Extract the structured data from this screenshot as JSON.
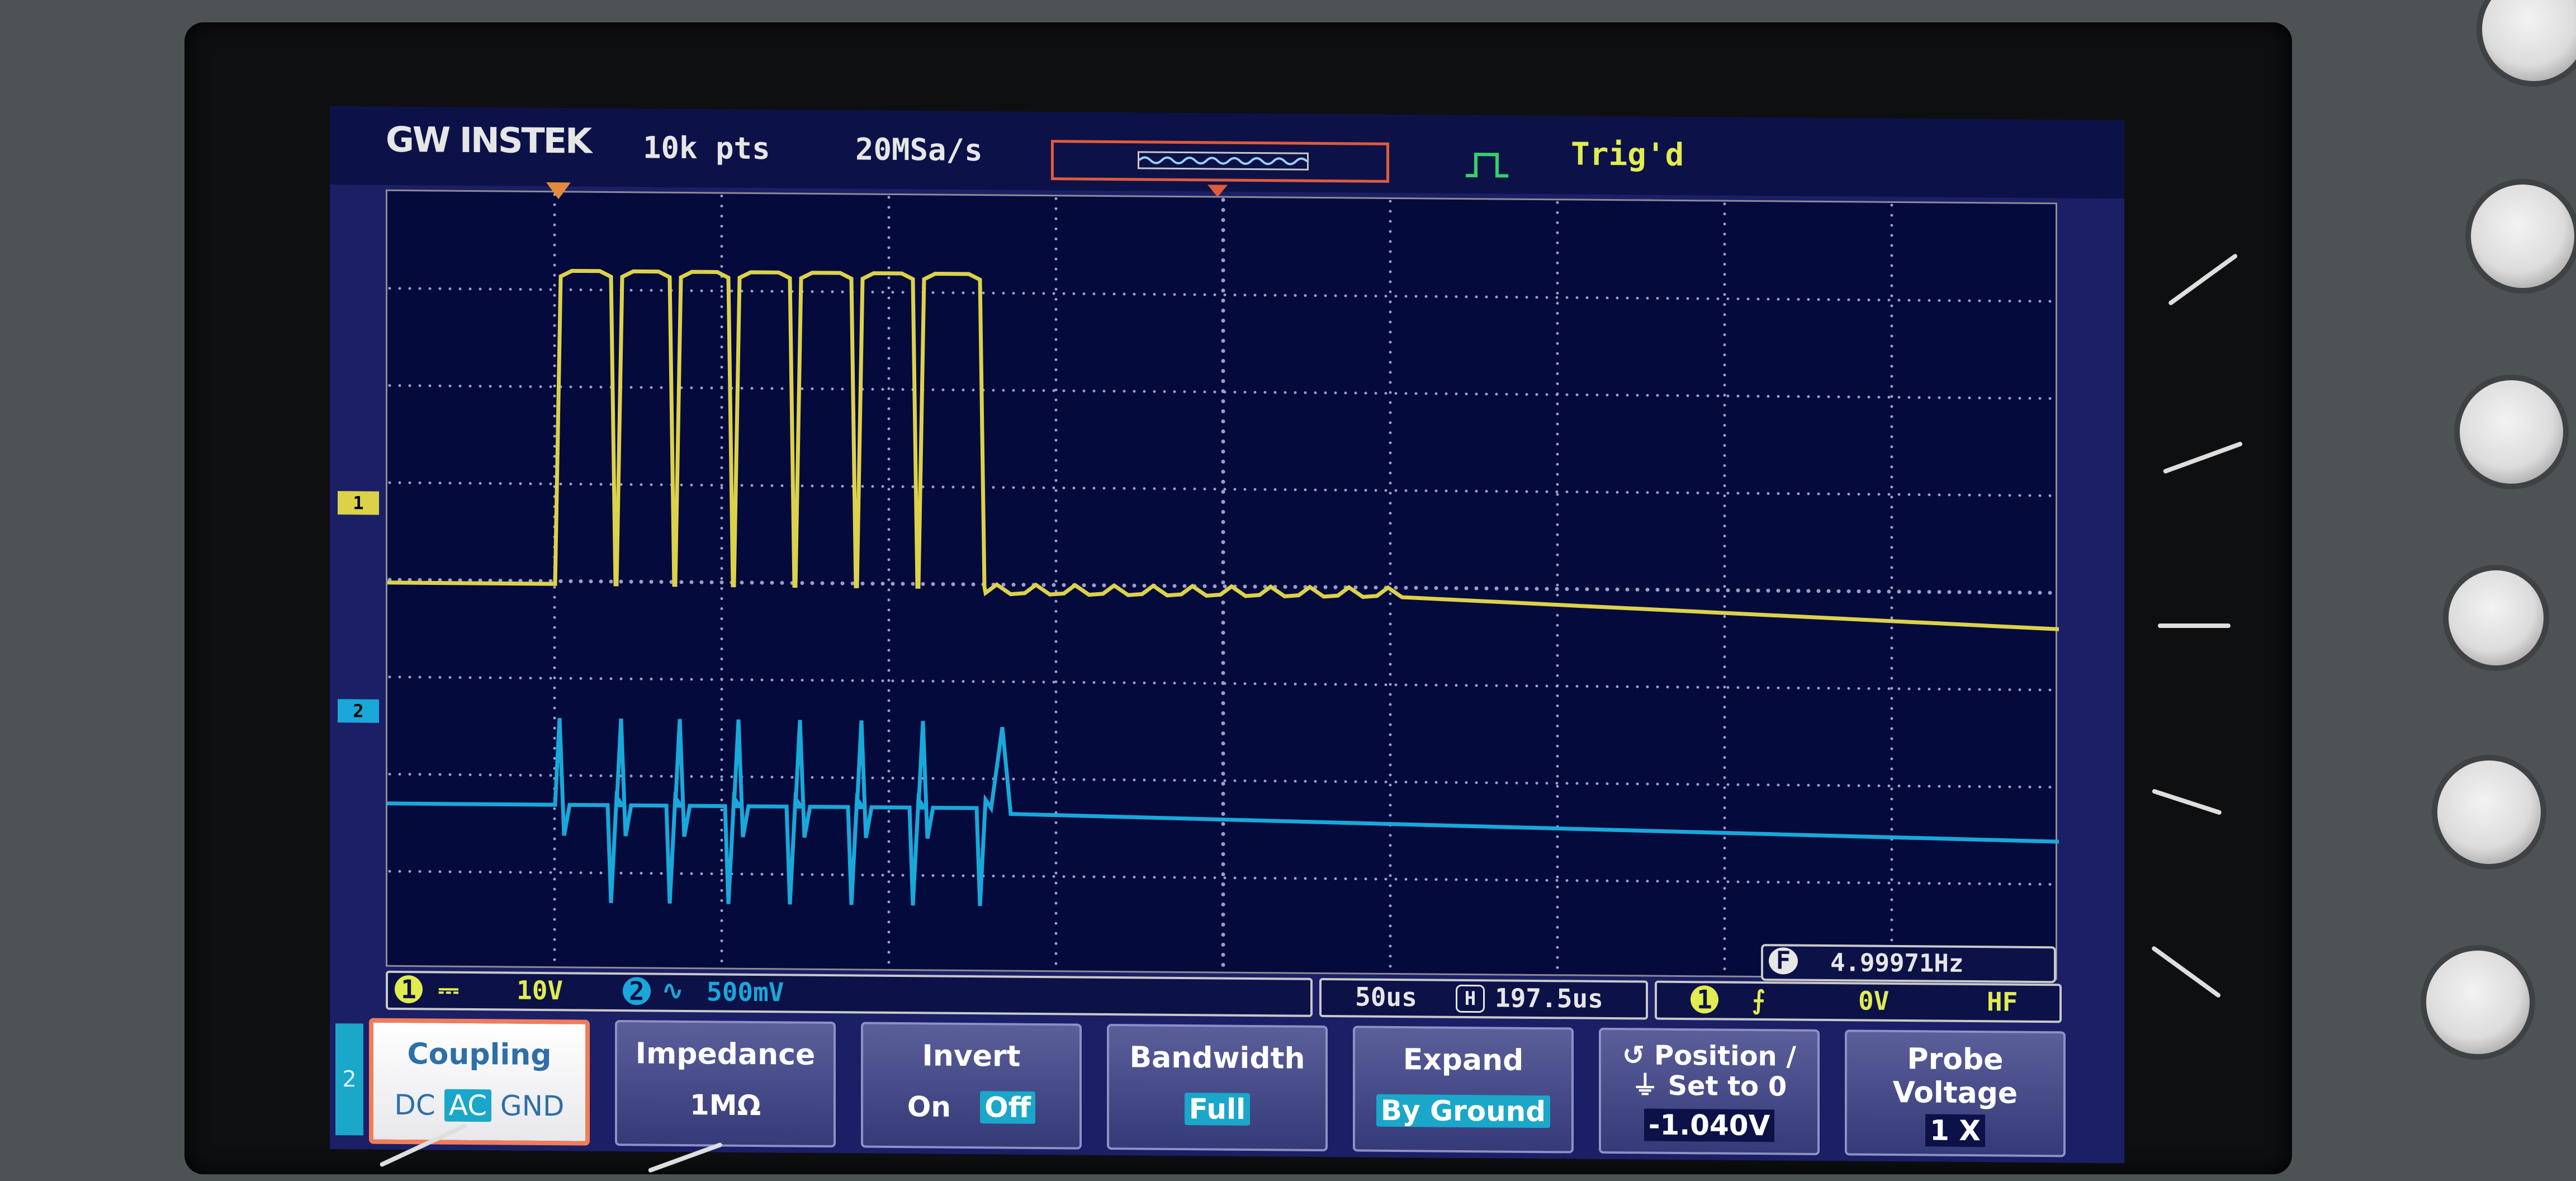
{
  "brand": "GW INSTEK",
  "header": {
    "record_length": "10k pts",
    "sample_rate": "20MSa/s",
    "trigger_status": "Trig'd"
  },
  "channels": {
    "ch1": {
      "marker": "1",
      "color": "#dcd24a"
    },
    "ch2": {
      "marker": "2",
      "color": "#1aa7d9"
    }
  },
  "status": {
    "ch1_num": "1",
    "ch1_scale": "10V",
    "ch2_num": "2",
    "ch2_scale": "500mV",
    "timebase": "50us",
    "horizontal_position": "197.5us",
    "trigger_source": "1",
    "trigger_level": "0V",
    "trigger_coupling": "HF",
    "frequency_label": "F",
    "frequency": "4.99971Hz"
  },
  "menu": {
    "channel_tab": "2",
    "coupling": {
      "title": "Coupling",
      "options": [
        "DC",
        "AC",
        "GND"
      ],
      "selected": "AC"
    },
    "impedance": {
      "title": "Impedance",
      "value": "1MΩ"
    },
    "invert": {
      "title": "Invert",
      "on": "On",
      "off": "Off",
      "selected": "Off"
    },
    "bandwidth": {
      "title": "Bandwidth",
      "value": "Full"
    },
    "expand": {
      "title": "Expand",
      "value": "By Ground"
    },
    "position": {
      "title_line1": "Position /",
      "title_line2": "Set to 0",
      "value": "-1.040V"
    },
    "probe": {
      "title_line1": "Probe",
      "title_line2": "Voltage",
      "value": "1 X"
    }
  }
}
